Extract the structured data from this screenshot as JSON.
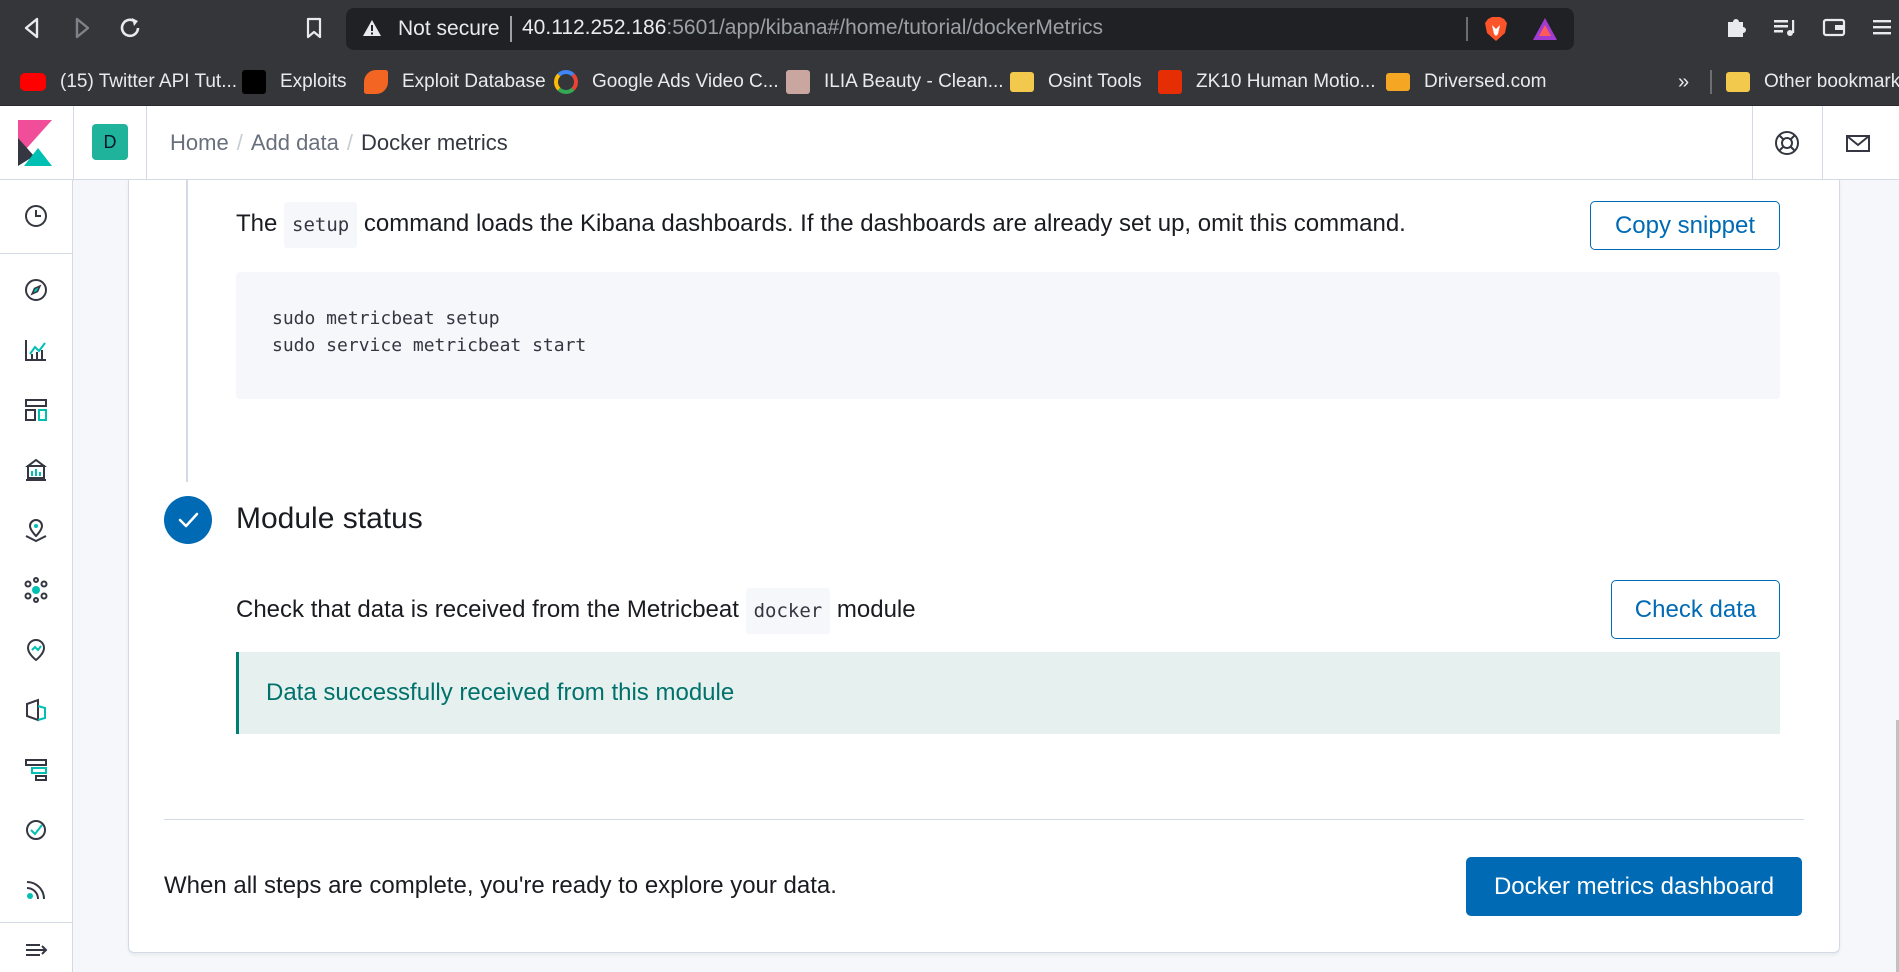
{
  "browser": {
    "not_secure": "Not secure",
    "url_host": "40.112.252.186",
    "url_path": ":5601/app/kibana#/home/tutorial/dockerMetrics",
    "bookmarks": [
      {
        "label": "(15) Twitter API Tut...",
        "icon": "youtube-icon",
        "color": "#ff0000"
      },
      {
        "label": "Exploits",
        "icon": "exploit-icon",
        "color": "#000000"
      },
      {
        "label": "Exploit Database",
        "icon": "exploit-db-icon",
        "color": "#f26522"
      },
      {
        "label": "Google Ads Video C...",
        "icon": "google-icon",
        "color": "#4285f4"
      },
      {
        "label": "ILIA Beauty - Clean...",
        "icon": "ilia-icon",
        "color": "#c9a7a0"
      },
      {
        "label": "Osint Tools",
        "icon": "folder-icon",
        "color": "#f2c94c"
      },
      {
        "label": "ZK10 Human Motio...",
        "icon": "aliexpress-icon",
        "color": "#e62e04"
      },
      {
        "label": "Driversed.com",
        "icon": "driversed-icon",
        "color": "#f5a623"
      }
    ],
    "more_bookmarks": "»",
    "other_bookmarks": "Other bookmarks"
  },
  "kibana": {
    "space_initial": "D",
    "breadcrumbs": [
      "Home",
      "Add data",
      "Docker metrics"
    ],
    "breadcrumb_separator": "/"
  },
  "setup_step": {
    "text_before": "The",
    "command": "setup",
    "text_after": "command loads the Kibana dashboards. If the dashboards are already set up, omit this command.",
    "copy_label": "Copy snippet",
    "code_lines": [
      "sudo metricbeat setup",
      "sudo service metricbeat start"
    ]
  },
  "status_step": {
    "title": "Module status",
    "text_before": "Check that data is received from the Metricbeat",
    "module": "docker",
    "text_after": "module",
    "check_label": "Check data",
    "callout": "Data successfully received from this module"
  },
  "footer": {
    "text": "When all steps are complete, you're ready to explore your data.",
    "button_label": "Docker metrics dashboard"
  },
  "colors": {
    "primary": "#006bb4",
    "success": "#017d73",
    "space_badge": "#20b39c"
  }
}
